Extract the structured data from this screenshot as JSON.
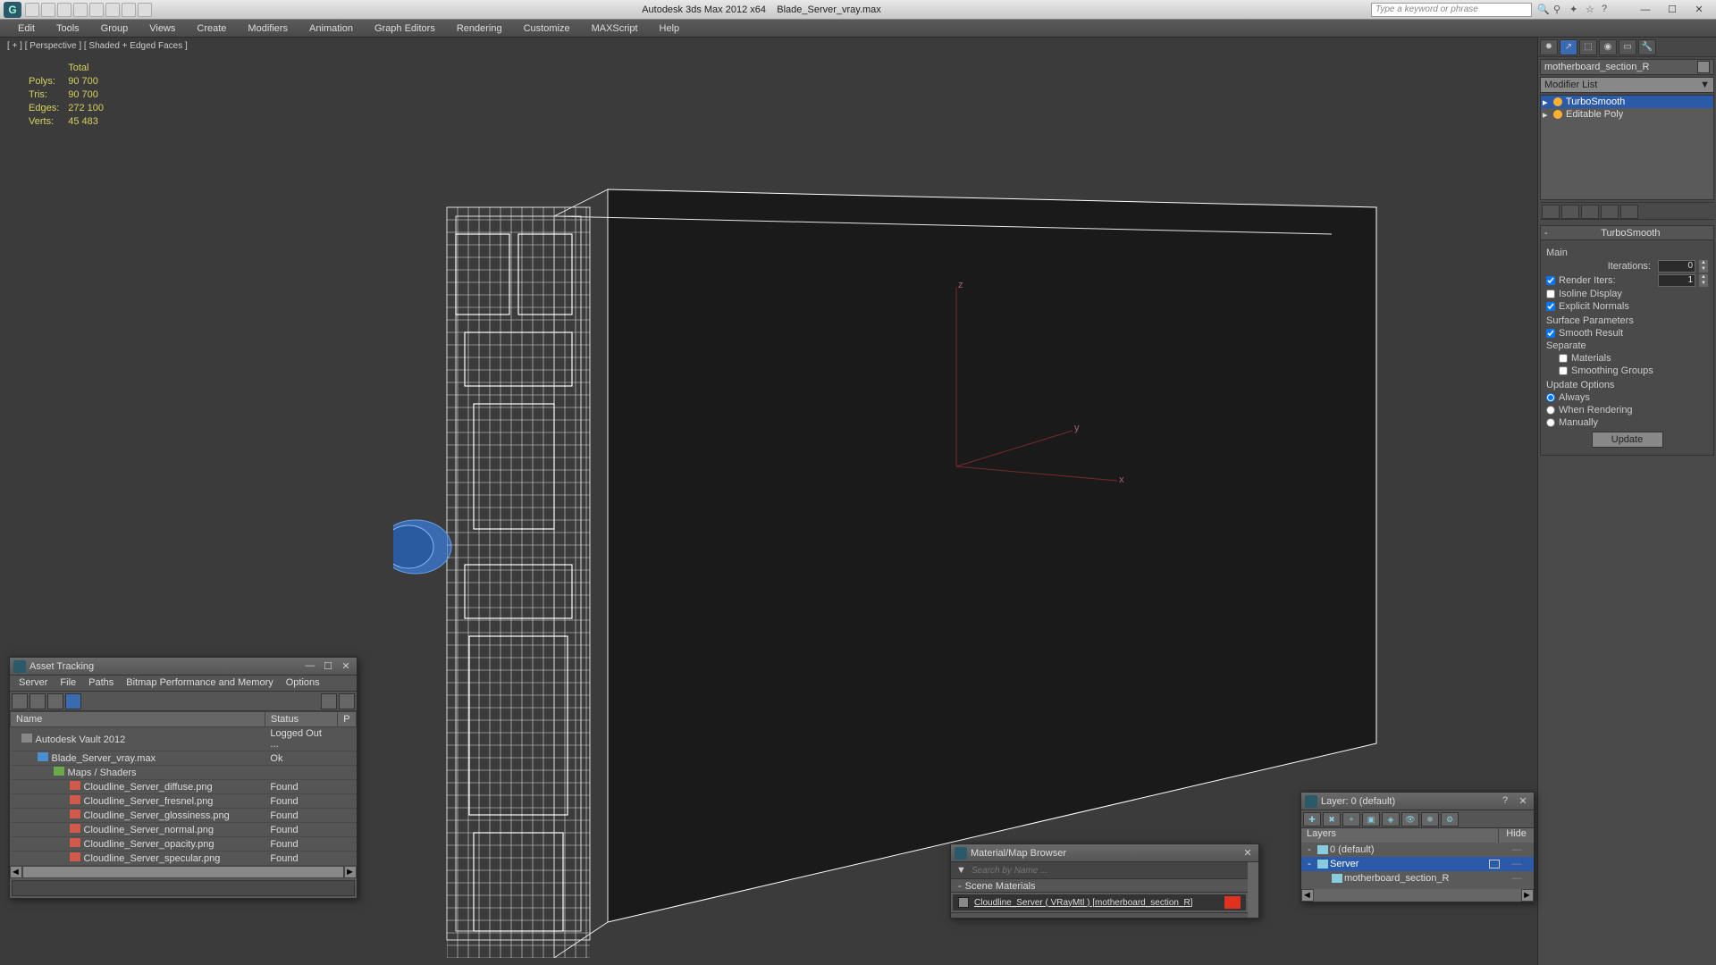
{
  "titlebar": {
    "app_title": "Autodesk 3ds Max 2012 x64",
    "file_name": "Blade_Server_vray.max",
    "search_placeholder": "Type a keyword or phrase"
  },
  "menubar": [
    "Edit",
    "Tools",
    "Group",
    "Views",
    "Create",
    "Modifiers",
    "Animation",
    "Graph Editors",
    "Rendering",
    "Customize",
    "MAXScript",
    "Help"
  ],
  "viewport": {
    "label": "[ + ] [ Perspective ] [ Shaded + Edged Faces ]",
    "stats": {
      "title": "Total",
      "polys_label": "Polys:",
      "polys": "90 700",
      "tris_label": "Tris:",
      "tris": "90 700",
      "edges_label": "Edges:",
      "edges": "272 100",
      "verts_label": "Verts:",
      "verts": "45 483"
    },
    "axes": {
      "z": "z",
      "y": "y",
      "x": "x"
    }
  },
  "cmdpanel": {
    "object_name": "motherboard_section_R",
    "modifier_list_label": "Modifier List",
    "stack": [
      {
        "name": "TurboSmooth",
        "selected": true
      },
      {
        "name": "Editable Poly",
        "selected": false
      }
    ],
    "rollout": {
      "title": "TurboSmooth",
      "main_label": "Main",
      "iterations_label": "Iterations:",
      "iterations_value": "0",
      "render_iters_label": "Render Iters:",
      "render_iters_value": "1",
      "isoline_label": "Isoline Display",
      "explicit_label": "Explicit Normals",
      "surface_label": "Surface Parameters",
      "smooth_result_label": "Smooth Result",
      "separate_label": "Separate",
      "materials_label": "Materials",
      "smoothing_groups_label": "Smoothing Groups",
      "update_options_label": "Update Options",
      "always_label": "Always",
      "when_rendering_label": "When Rendering",
      "manually_label": "Manually",
      "update_button": "Update"
    }
  },
  "asset": {
    "title": "Asset Tracking",
    "menu": [
      "Server",
      "File",
      "Paths",
      "Bitmap Performance and Memory",
      "Options"
    ],
    "columns": {
      "name": "Name",
      "status": "Status",
      "p": "P"
    },
    "rows": [
      {
        "indent": 0,
        "icon": "vault",
        "name": "Autodesk Vault 2012",
        "status": "Logged Out ..."
      },
      {
        "indent": 1,
        "icon": "max",
        "name": "Blade_Server_vray.max",
        "status": "Ok"
      },
      {
        "indent": 2,
        "icon": "folder",
        "name": "Maps / Shaders",
        "status": ""
      },
      {
        "indent": 3,
        "icon": "png",
        "name": "Cloudline_Server_diffuse.png",
        "status": "Found"
      },
      {
        "indent": 3,
        "icon": "png",
        "name": "Cloudline_Server_fresnel.png",
        "status": "Found"
      },
      {
        "indent": 3,
        "icon": "png",
        "name": "Cloudline_Server_glossiness.png",
        "status": "Found"
      },
      {
        "indent": 3,
        "icon": "png",
        "name": "Cloudline_Server_normal.png",
        "status": "Found"
      },
      {
        "indent": 3,
        "icon": "png",
        "name": "Cloudline_Server_opacity.png",
        "status": "Found"
      },
      {
        "indent": 3,
        "icon": "png",
        "name": "Cloudline_Server_specular.png",
        "status": "Found"
      }
    ]
  },
  "material": {
    "title": "Material/Map Browser",
    "search_placeholder": "Search by Name ...",
    "section": "Scene Materials",
    "item": "Cloudline_Server ( VRayMtl )  [motherboard_section_R]"
  },
  "layers": {
    "title": "Layer: 0 (default)",
    "columns": {
      "layers": "Layers",
      "hide": "Hide"
    },
    "rows": [
      {
        "indent": 0,
        "exp": "-",
        "name": "0 (default)",
        "selected": false,
        "hide": "—"
      },
      {
        "indent": 0,
        "exp": "-",
        "name": "Server",
        "selected": true,
        "hide": "—",
        "checkbox": true
      },
      {
        "indent": 1,
        "exp": "",
        "name": "motherboard_section_R",
        "selected": false,
        "hide": "—"
      }
    ]
  }
}
